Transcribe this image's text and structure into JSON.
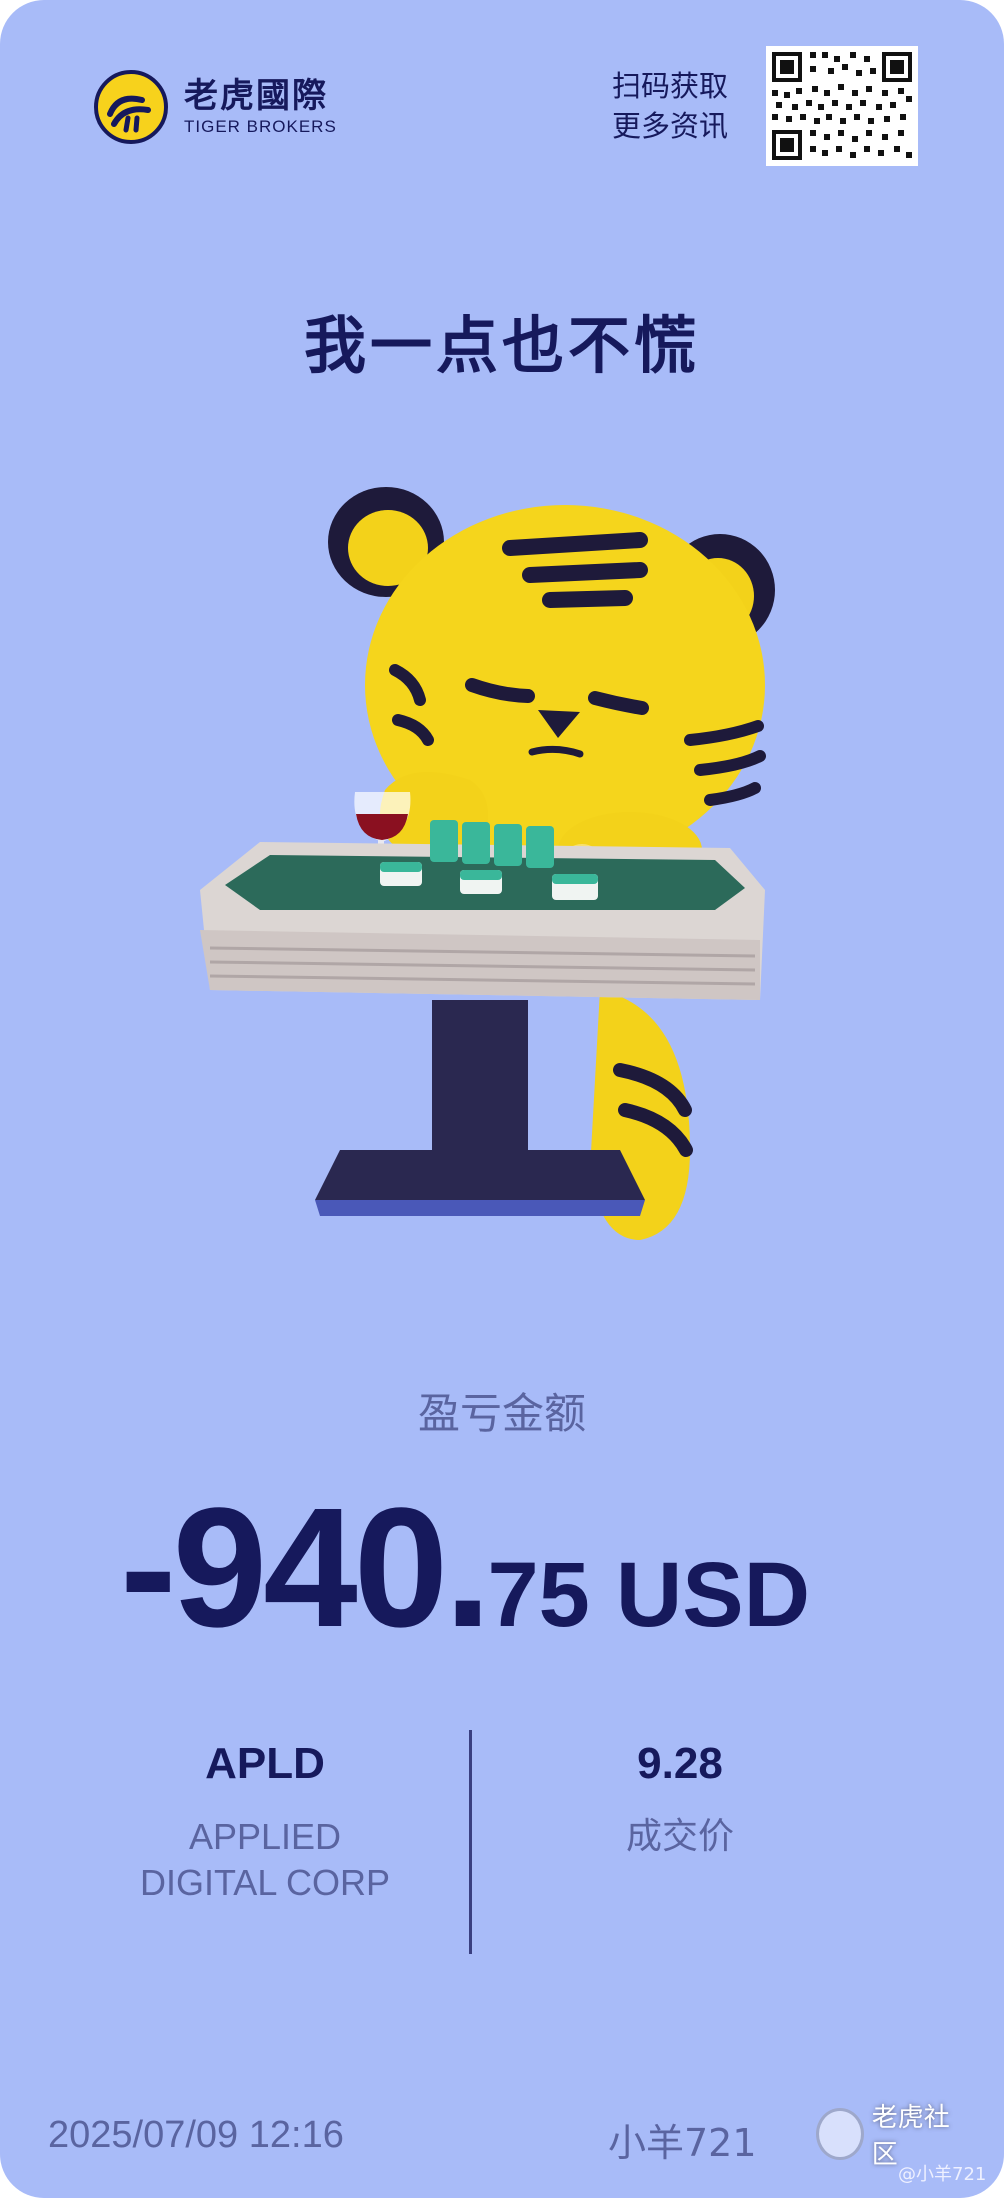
{
  "brand": {
    "name_cn": "老虎國際",
    "name_en": "TIGER BROKERS"
  },
  "header": {
    "scan_line1": "扫码获取",
    "scan_line2": "更多资讯"
  },
  "headline": "我一点也不慌",
  "pnl": {
    "label": "盈亏金额",
    "integer_part": "-940.",
    "decimal_part": "75",
    "currency": "USD"
  },
  "stock": {
    "ticker": "APLD",
    "company_line1": "APPLIED",
    "company_line2": "DIGITAL CORP"
  },
  "trade": {
    "price": "9.28",
    "price_label": "成交价"
  },
  "footer": {
    "datetime": "2025/07/09 12:16",
    "username": "小羊721"
  },
  "watermark": {
    "text": "老虎社区",
    "sub": "@小羊721"
  },
  "colors": {
    "background": "#a8bbf8",
    "primary_text": "#16195c",
    "secondary_text": "#5a64a0",
    "tiger_yellow": "#f7d21c"
  },
  "icons": [
    "tiger-logo-icon",
    "qr-code-icon",
    "tiger-mascot-illustration",
    "watermark-icon"
  ]
}
